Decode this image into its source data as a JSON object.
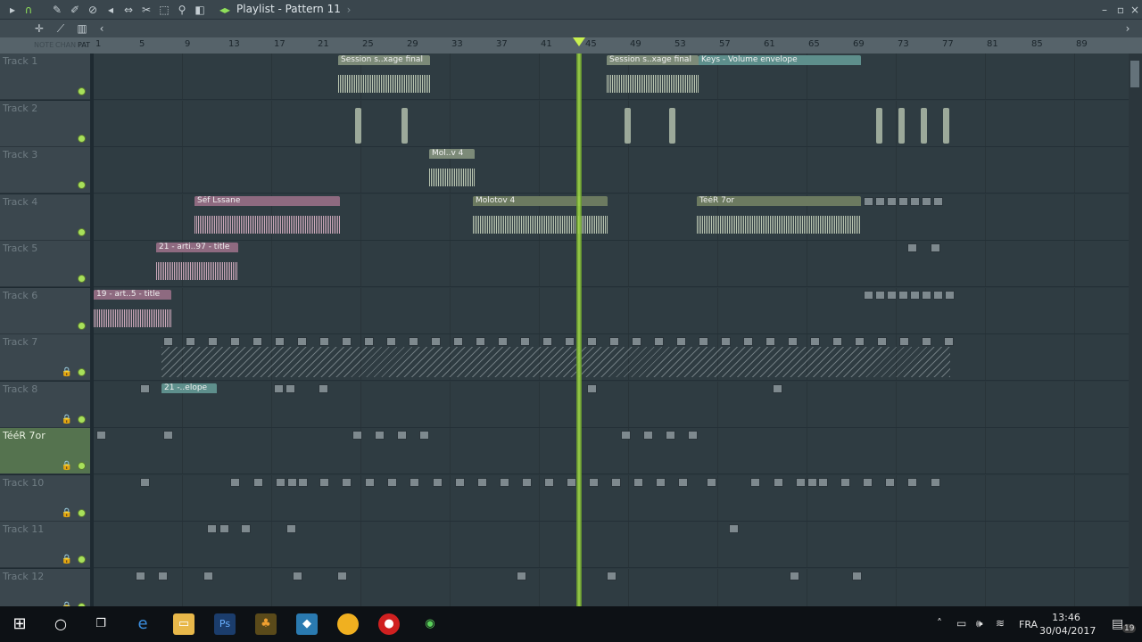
{
  "window": {
    "title": "Playlist - Pattern 11"
  },
  "ruler": {
    "labels": [
      "1",
      "5",
      "9",
      "13",
      "17",
      "21",
      "25",
      "29",
      "33",
      "37",
      "41",
      "45",
      "49",
      "53",
      "57",
      "61",
      "65",
      "69",
      "73",
      "77",
      "81",
      "85",
      "89"
    ],
    "toolbar_labels": [
      "NOTE",
      "CHAN",
      "PAT"
    ]
  },
  "tracks": [
    {
      "name": "Track 1"
    },
    {
      "name": "Track 2"
    },
    {
      "name": "Track 3"
    },
    {
      "name": "Track 4"
    },
    {
      "name": "Track 5"
    },
    {
      "name": "Track 6"
    },
    {
      "name": "Track 7"
    },
    {
      "name": "Track 8"
    },
    {
      "name": "TééR 7or",
      "selected": true
    },
    {
      "name": "Track 10"
    },
    {
      "name": "Track 11"
    },
    {
      "name": "Track 12"
    }
  ],
  "clips": {
    "session1": "Session s..xage final",
    "session2": "Session s..xage final",
    "keys_env": "Keys - Volume envelope",
    "molotov_short": "Mol..v 4",
    "sef_lssane": "Séf Lssane",
    "molotov": "Molotov 4",
    "teer": "TééR 7or",
    "track5_clip": "21 - arti..97 - title",
    "track6_clip": "19 - art..5 - title",
    "track8_env": "21 -..elope"
  },
  "colors": {
    "accent": "#a8e04a",
    "audio": "#b8c4b0",
    "pink": "#c9a6b8",
    "teal": "#5e8f8c"
  },
  "taskbar": {
    "lang": "FRA",
    "time": "13:46",
    "date": "30/04/2017",
    "notifications": "19"
  }
}
